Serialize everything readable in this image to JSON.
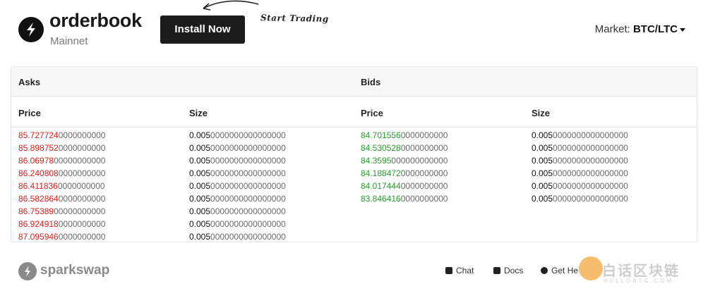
{
  "header": {
    "brand": "orderbook",
    "network": "Mainnet",
    "install_label": "Install Now",
    "annotation": "Start Trading",
    "market_label": "Market:",
    "market_pair": "BTC/LTC"
  },
  "orderbook": {
    "asks_title": "Asks",
    "bids_title": "Bids",
    "price_label": "Price",
    "size_label": "Size",
    "asks": [
      {
        "price_main": "85.727724",
        "price_rest": "0000000000",
        "size_main": "0.005",
        "size_rest": "0000000000000000"
      },
      {
        "price_main": "85.898752",
        "price_rest": "0000000000",
        "size_main": "0.005",
        "size_rest": "0000000000000000"
      },
      {
        "price_main": "86.06978",
        "price_rest": "00000000000",
        "size_main": "0.005",
        "size_rest": "0000000000000000"
      },
      {
        "price_main": "86.240808",
        "price_rest": "0000000000",
        "size_main": "0.005",
        "size_rest": "0000000000000000"
      },
      {
        "price_main": "86.411836",
        "price_rest": "0000000000",
        "size_main": "0.005",
        "size_rest": "0000000000000000"
      },
      {
        "price_main": "86.582864",
        "price_rest": "0000000000",
        "size_main": "0.005",
        "size_rest": "0000000000000000"
      },
      {
        "price_main": "86.75389",
        "price_rest": "00000000000",
        "size_main": "0.005",
        "size_rest": "0000000000000000"
      },
      {
        "price_main": "86.924918",
        "price_rest": "0000000000",
        "size_main": "0.005",
        "size_rest": "0000000000000000"
      },
      {
        "price_main": "87.095946",
        "price_rest": "0000000000",
        "size_main": "0.005",
        "size_rest": "0000000000000000"
      }
    ],
    "bids": [
      {
        "price_main": "84.701556",
        "price_rest": "0000000000",
        "size_main": "0.005",
        "size_rest": "0000000000000000"
      },
      {
        "price_main": "84.530528",
        "price_rest": "0000000000",
        "size_main": "0.005",
        "size_rest": "0000000000000000"
      },
      {
        "price_main": "84.3595",
        "price_rest": "000000000000",
        "size_main": "0.005",
        "size_rest": "0000000000000000"
      },
      {
        "price_main": "84.188472",
        "price_rest": "0000000000",
        "size_main": "0.005",
        "size_rest": "0000000000000000"
      },
      {
        "price_main": "84.017444",
        "price_rest": "0000000000",
        "size_main": "0.005",
        "size_rest": "0000000000000000"
      },
      {
        "price_main": "83.846416",
        "price_rest": "0000000000",
        "size_main": "0.005",
        "size_rest": "0000000000000000"
      }
    ]
  },
  "footer": {
    "brand": "sparkswap",
    "links": [
      {
        "label": "Chat",
        "icon": "chat-icon"
      },
      {
        "label": "Docs",
        "icon": "document-icon"
      },
      {
        "label": "Get He",
        "icon": "help-icon"
      }
    ],
    "watermark_text": "白话区块链",
    "watermark_sub": "HELLOBTC.COM"
  },
  "colors": {
    "ask": "#d9201d",
    "bid": "#2b9a2f",
    "button_bg": "#1c1c1c"
  }
}
